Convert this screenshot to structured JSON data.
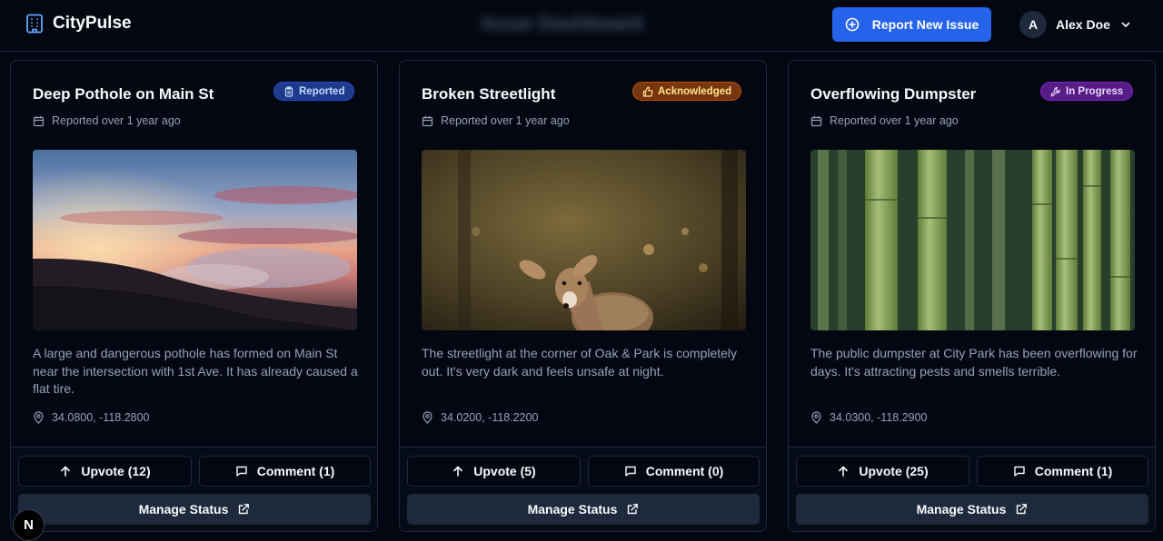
{
  "header": {
    "app_name": "CityPulse",
    "page_title": "Issue Dashboard",
    "report_button_label": "Report New Issue",
    "user": {
      "initial": "A",
      "name": "Alex Doe"
    }
  },
  "cards": [
    {
      "title": "Deep Pothole on Main St",
      "status": "Reported",
      "reported_time": "Reported over 1 year ago",
      "image_description": "sunset-clouds",
      "description": "A large and dangerous pothole has formed on Main St near the intersection with 1st Ave. It has already caused a flat tire.",
      "coordinates": "34.0800, -118.2800",
      "upvote_label": "Upvote (12)",
      "comment_label": "Comment (1)",
      "manage_label": "Manage Status"
    },
    {
      "title": "Broken Streetlight",
      "status": "Acknowledged",
      "reported_time": "Reported over 1 year ago",
      "image_description": "deer-in-forest",
      "description": "The streetlight at the corner of Oak & Park is completely out. It's very dark and feels unsafe at night.",
      "coordinates": "34.0200, -118.2200",
      "upvote_label": "Upvote (5)",
      "comment_label": "Comment (0)",
      "manage_label": "Manage Status"
    },
    {
      "title": "Overflowing Dumpster",
      "status": "In Progress",
      "reported_time": "Reported over 1 year ago",
      "image_description": "bamboo-forest",
      "description": "The public dumpster at City Park has been overflowing for days. It's attracting pests and smells terrible.",
      "coordinates": "34.0300, -118.2900",
      "upvote_label": "Upvote (25)",
      "comment_label": "Comment (1)",
      "manage_label": "Manage Status"
    }
  ],
  "fab": {
    "label": "N"
  },
  "colors": {
    "background": "#030711",
    "primary": "#2563eb",
    "status_reported": "#1e3a8a",
    "status_acknowledged": "#78350f",
    "status_in_progress": "#581c87"
  }
}
